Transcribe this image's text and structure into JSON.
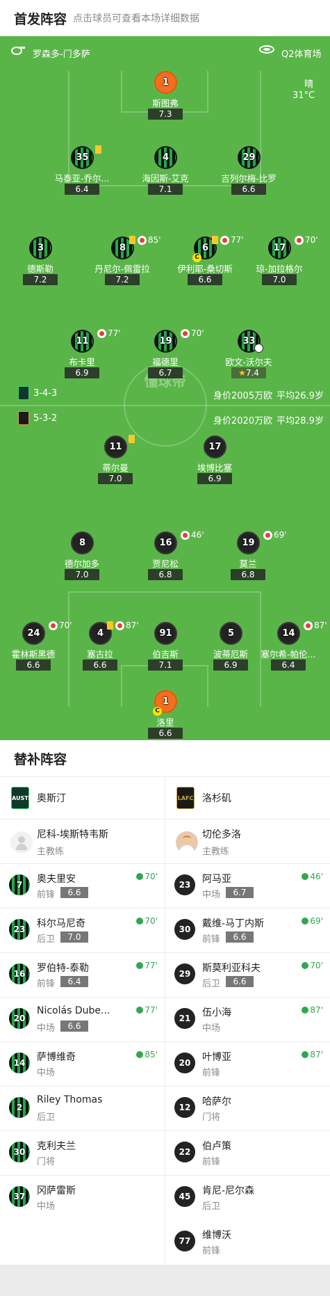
{
  "header": {
    "title": "首发阵容",
    "subtitle": "点击球员可查看本场详细数据"
  },
  "venue": {
    "match": "罗森多-门多萨",
    "stadium": "Q2体育场",
    "weather": "晴",
    "temp": "31°C"
  },
  "watermark": "懂球帝",
  "formations": {
    "home": {
      "formation": "3-4-3",
      "worth": "身价2005万欧",
      "age": "平均26.9岁"
    },
    "away": {
      "formation": "5-3-2",
      "worth": "身价2020万欧",
      "age": "平均28.9岁"
    }
  },
  "home_players": [
    {
      "num": "1",
      "name": "斯图弗",
      "rating": "7.3",
      "gk": true
    },
    {
      "num": "35",
      "name": "马泰亚-乔尔...",
      "rating": "6.4",
      "yellow": true
    },
    {
      "num": "4",
      "name": "海因斯-艾克",
      "rating": "7.1"
    },
    {
      "num": "29",
      "name": "吉列尔梅-比罗",
      "rating": "6.6"
    },
    {
      "num": "3",
      "name": "德斯勒",
      "rating": "7.2"
    },
    {
      "num": "8",
      "name": "丹尼尔-佩雷拉",
      "rating": "7.2",
      "yellow": true,
      "subTime": "85'"
    },
    {
      "num": "6",
      "name": "伊利耶-桑切斯",
      "rating": "6.6",
      "yellow": true,
      "subTime": "77'",
      "captain": "C"
    },
    {
      "num": "17",
      "name": "琼-加拉格尔",
      "rating": "7.0",
      "subTime": "70'"
    },
    {
      "num": "11",
      "name": "布卡里",
      "rating": "6.9",
      "subTime": "77'"
    },
    {
      "num": "19",
      "name": "福德里",
      "rating": "6.7",
      "subTime": "70'"
    },
    {
      "num": "33",
      "name": "欧文-沃尔夫",
      "rating": "7.4",
      "goal": true,
      "best": true
    }
  ],
  "away_players": [
    {
      "num": "11",
      "name": "蒂尔曼",
      "rating": "7.0",
      "yellow": true
    },
    {
      "num": "17",
      "name": "埃博比塞",
      "rating": "6.9"
    },
    {
      "num": "8",
      "name": "德尔加多",
      "rating": "7.0"
    },
    {
      "num": "16",
      "name": "贾尼松",
      "rating": "6.8",
      "subTime": "46'"
    },
    {
      "num": "19",
      "name": "莫兰",
      "rating": "6.8",
      "subTime": "69'"
    },
    {
      "num": "24",
      "name": "霍林斯黑德",
      "rating": "6.6",
      "subTime": "70'"
    },
    {
      "num": "4",
      "name": "塞古拉",
      "rating": "6.6",
      "yellow": true,
      "subTime": "87'"
    },
    {
      "num": "91",
      "name": "伯吉斯",
      "rating": "7.1"
    },
    {
      "num": "5",
      "name": "波蒂厄斯",
      "rating": "6.9"
    },
    {
      "num": "14",
      "name": "塞尔希-帕伦...",
      "rating": "6.4",
      "subTime": "87'"
    },
    {
      "num": "1",
      "name": "洛里",
      "rating": "6.6",
      "gk": true,
      "captain": "C"
    }
  ],
  "subs": {
    "title": "替补阵容",
    "home_team": "奥斯汀",
    "away_team": "洛杉矶",
    "home_logo_text": "AUSTIN",
    "away_logo_text": "LAFC",
    "home_coach": {
      "name": "尼科-埃斯特韦斯",
      "role": "主教练"
    },
    "away_coach": {
      "name": "切伦多洛",
      "role": "主教练"
    },
    "home_list": [
      {
        "num": "7",
        "name": "奥夫里安",
        "pos": "前锋",
        "rating": "6.6",
        "time": "70'"
      },
      {
        "num": "23",
        "name": "科尔马尼奇",
        "pos": "后卫",
        "rating": "7.0",
        "time": "70'"
      },
      {
        "num": "16",
        "name": "罗伯特-泰勒",
        "pos": "前锋",
        "rating": "6.4",
        "time": "77'"
      },
      {
        "num": "20",
        "name": "Nicolás Dube...",
        "pos": "中场",
        "rating": "6.6",
        "time": "77'"
      },
      {
        "num": "14",
        "name": "萨博维奇",
        "pos": "中场",
        "rating": "",
        "time": "85'"
      },
      {
        "num": "2",
        "name": "Riley Thomas",
        "pos": "后卫",
        "rating": "",
        "time": ""
      },
      {
        "num": "30",
        "name": "克利夫兰",
        "pos": "门将",
        "rating": "",
        "time": ""
      },
      {
        "num": "37",
        "name": "冈萨雷斯",
        "pos": "中场",
        "rating": "",
        "time": ""
      }
    ],
    "away_list": [
      {
        "num": "23",
        "name": "阿马亚",
        "pos": "中场",
        "rating": "6.7",
        "time": "46'"
      },
      {
        "num": "30",
        "name": "戴维-马丁内斯",
        "pos": "前锋",
        "rating": "6.6",
        "time": "69'"
      },
      {
        "num": "29",
        "name": "斯莫利亚科夫",
        "pos": "后卫",
        "rating": "6.6",
        "time": "70'"
      },
      {
        "num": "21",
        "name": "伍小海",
        "pos": "中场",
        "rating": "",
        "time": "87'"
      },
      {
        "num": "20",
        "name": "叶博亚",
        "pos": "前锋",
        "rating": "",
        "time": "87'"
      },
      {
        "num": "12",
        "name": "哈萨尔",
        "pos": "门将",
        "rating": "",
        "time": ""
      },
      {
        "num": "22",
        "name": "伯卢策",
        "pos": "前锋",
        "rating": "",
        "time": ""
      },
      {
        "num": "45",
        "name": "肯尼-尼尔森",
        "pos": "后卫",
        "rating": "",
        "time": ""
      },
      {
        "num": "77",
        "name": "维博沃",
        "pos": "前锋",
        "rating": "",
        "time": ""
      }
    ]
  },
  "colors": {
    "pitch": "#5ab548",
    "home_kit": "#20a94a",
    "away_kit": "#232323",
    "gk": "#f26f1f",
    "yellow": "#f7c82a"
  }
}
